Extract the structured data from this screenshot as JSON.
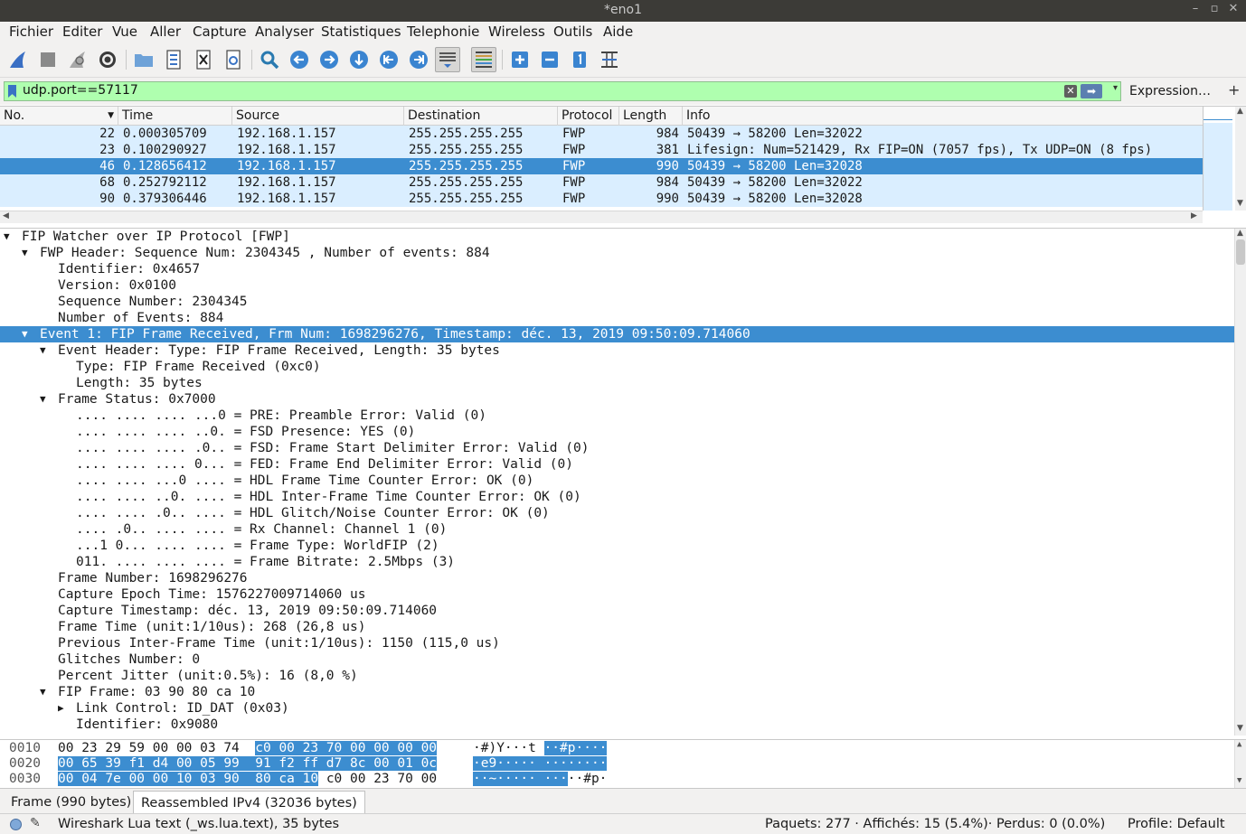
{
  "window": {
    "title": "*eno1"
  },
  "menu": [
    "Fichier",
    "Editer",
    "Vue",
    "Aller",
    "Capture",
    "Analyser",
    "Statistiques",
    "Telephonie",
    "Wireless",
    "Outils",
    "Aide"
  ],
  "toolbar": {
    "icons": [
      "shark-fin-start-icon",
      "stop-square-icon",
      "shark-fin-restart-icon",
      "options-gear-icon",
      "open-folder-icon",
      "save-file-icon",
      "close-file-icon",
      "reload-icon",
      "find-magnifier-icon",
      "go-back-icon",
      "go-forward-icon",
      "go-to-packet-icon",
      "go-first-icon",
      "go-last-icon",
      "autoscroll-icon",
      "colorize-icon",
      "zoom-in-icon",
      "zoom-out-icon",
      "normal-size-icon",
      "resize-columns-icon"
    ]
  },
  "filter": {
    "value": "udp.port==57117",
    "expression_label": "Expression…",
    "add_label": "+"
  },
  "packet_list": {
    "columns": [
      "No.",
      "Time",
      "Source",
      "Destination",
      "Protocol",
      "Length",
      "Info"
    ],
    "rows": [
      {
        "no": "22",
        "time": "0.000305709",
        "src": "192.168.1.157",
        "dst": "255.255.255.255",
        "proto": "FWP",
        "len": "984",
        "info": "50439 → 58200 Len=32022",
        "selected": false
      },
      {
        "no": "23",
        "time": "0.100290927",
        "src": "192.168.1.157",
        "dst": "255.255.255.255",
        "proto": "FWP",
        "len": "381",
        "info": "Lifesign: Num=521429, Rx FIP=ON (7057 fps), Tx UDP=ON (8 fps)",
        "selected": false
      },
      {
        "no": "46",
        "time": "0.128656412",
        "src": "192.168.1.157",
        "dst": "255.255.255.255",
        "proto": "FWP",
        "len": "990",
        "info": "50439 → 58200 Len=32028",
        "selected": true
      },
      {
        "no": "68",
        "time": "0.252792112",
        "src": "192.168.1.157",
        "dst": "255.255.255.255",
        "proto": "FWP",
        "len": "984",
        "info": "50439 → 58200 Len=32022",
        "selected": false
      },
      {
        "no": "90",
        "time": "0.379306446",
        "src": "192.168.1.157",
        "dst": "255.255.255.255",
        "proto": "FWP",
        "len": "990",
        "info": "50439 → 58200 Len=32028",
        "selected": false
      }
    ]
  },
  "details": [
    {
      "level": 0,
      "arrow": "open",
      "text": "FIP Watcher over IP Protocol [FWP]"
    },
    {
      "level": 1,
      "arrow": "open",
      "text": "FWP Header: Sequence Num: 2304345 , Number of events: 884"
    },
    {
      "level": 2,
      "arrow": "",
      "text": "Identifier: 0x4657"
    },
    {
      "level": 2,
      "arrow": "",
      "text": "Version: 0x0100"
    },
    {
      "level": 2,
      "arrow": "",
      "text": "Sequence Number: 2304345"
    },
    {
      "level": 2,
      "arrow": "",
      "text": "Number of Events: 884"
    },
    {
      "level": 1,
      "arrow": "open",
      "text": "Event 1: FIP Frame Received, Frm Num: 1698296276, Timestamp: déc. 13, 2019 09:50:09.714060",
      "selected": true
    },
    {
      "level": 2,
      "arrow": "open",
      "text": "Event Header: Type: FIP Frame Received, Length: 35 bytes"
    },
    {
      "level": 3,
      "arrow": "",
      "text": "Type: FIP Frame Received (0xc0)"
    },
    {
      "level": 3,
      "arrow": "",
      "text": "Length: 35 bytes"
    },
    {
      "level": 2,
      "arrow": "open",
      "text": "Frame Status: 0x7000"
    },
    {
      "level": 3,
      "arrow": "",
      "text": ".... .... .... ...0 = PRE: Preamble Error: Valid (0)"
    },
    {
      "level": 3,
      "arrow": "",
      "text": ".... .... .... ..0. = FSD Presence: YES (0)"
    },
    {
      "level": 3,
      "arrow": "",
      "text": ".... .... .... .0.. = FSD: Frame Start Delimiter Error: Valid (0)"
    },
    {
      "level": 3,
      "arrow": "",
      "text": ".... .... .... 0... = FED: Frame End Delimiter Error: Valid (0)"
    },
    {
      "level": 3,
      "arrow": "",
      "text": ".... .... ...0 .... = HDL Frame Time Counter Error: OK (0)"
    },
    {
      "level": 3,
      "arrow": "",
      "text": ".... .... ..0. .... = HDL Inter-Frame Time Counter Error: OK (0)"
    },
    {
      "level": 3,
      "arrow": "",
      "text": ".... .... .0.. .... = HDL Glitch/Noise Counter Error: OK (0)"
    },
    {
      "level": 3,
      "arrow": "",
      "text": ".... .0.. .... .... = Rx Channel: Channel 1 (0)"
    },
    {
      "level": 3,
      "arrow": "",
      "text": "...1 0... .... .... = Frame Type: WorldFIP (2)"
    },
    {
      "level": 3,
      "arrow": "",
      "text": "011. .... .... .... = Frame Bitrate: 2.5Mbps (3)"
    },
    {
      "level": 2,
      "arrow": "",
      "text": "Frame Number: 1698296276"
    },
    {
      "level": 2,
      "arrow": "",
      "text": "Capture Epoch Time: 1576227009714060 us"
    },
    {
      "level": 2,
      "arrow": "",
      "text": "Capture Timestamp: déc. 13, 2019 09:50:09.714060"
    },
    {
      "level": 2,
      "arrow": "",
      "text": "Frame Time (unit:1/10us): 268 (26,8 us)"
    },
    {
      "level": 2,
      "arrow": "",
      "text": "Previous Inter-Frame Time (unit:1/10us): 1150 (115,0 us)"
    },
    {
      "level": 2,
      "arrow": "",
      "text": "Glitches Number: 0"
    },
    {
      "level": 2,
      "arrow": "",
      "text": "Percent Jitter (unit:0.5%): 16 (8,0 %)"
    },
    {
      "level": 2,
      "arrow": "open",
      "text": "FIP Frame: 03 90 80 ca 10"
    },
    {
      "level": 3,
      "arrow": "closed",
      "text": "Link Control: ID_DAT (0x03)"
    },
    {
      "level": 3,
      "arrow": "",
      "text": "Identifier: 0x9080"
    }
  ],
  "bytes": [
    {
      "offset": "0010",
      "hex_plain": "00 23 29 59 00 00 03 74",
      "hex_hl": "c0 00 23 70 00 00 00 00",
      "hex_tail": "",
      "ascii_plain": "·#)Y···t",
      "ascii_hl": "··#p····",
      "ascii_tail": ""
    },
    {
      "offset": "0020",
      "hex_plain": "",
      "hex_hl": "00 65 39 f1 d4 00 05 99  91 f2 ff d7 8c 00 01 0c",
      "hex_tail": "",
      "ascii_plain": "",
      "ascii_hl": "·e9····· ········",
      "ascii_tail": ""
    },
    {
      "offset": "0030",
      "hex_plain": "",
      "hex_hl": "00 04 7e 00 00 10 03 90  80 ca 10",
      "hex_tail": "c0 00 23 70 00",
      "ascii_plain": "",
      "ascii_hl": "··~····· ···",
      "ascii_tail": "··#p·"
    }
  ],
  "tabs": [
    "Frame (990 bytes)",
    "Reassembled IPv4 (32036 bytes)"
  ],
  "status": {
    "field": "Wireshark Lua text (_ws.lua.text), 35 bytes",
    "packets": "Paquets: 277 · Affichés: 15 (5.4%)· Perdus: 0 (0.0%)",
    "profile": "Profile: Default"
  }
}
